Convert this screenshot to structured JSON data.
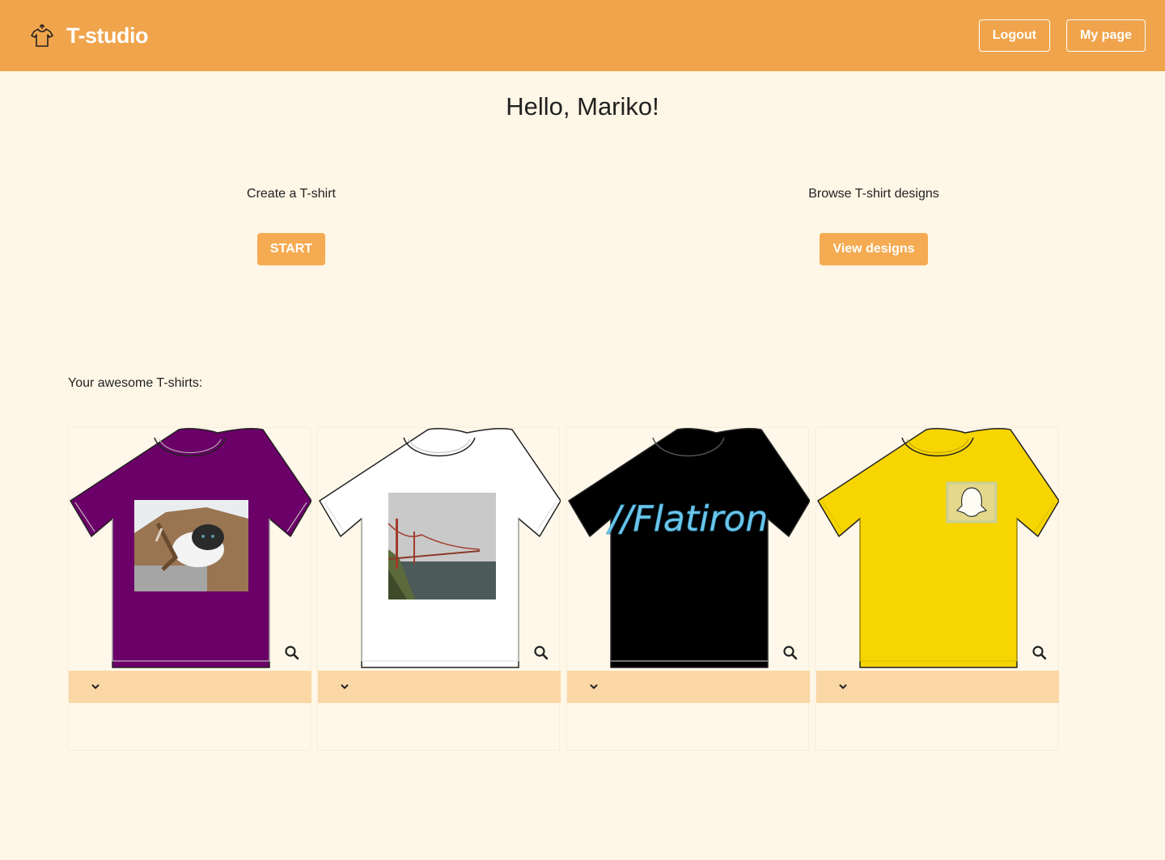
{
  "header": {
    "brand": "T-studio",
    "logo_icon": "tshirt-hanger-icon",
    "logout_label": "Logout",
    "mypage_label": "My page"
  },
  "greeting": "Hello, Mariko!",
  "create": {
    "label": "Create a T-shirt",
    "button": "START"
  },
  "browse": {
    "label": "Browse T-shirt designs",
    "button": "View designs"
  },
  "collection": {
    "title": "Your awesome T-shirts:",
    "shirts": [
      {
        "color": "#6b0068",
        "design": "cat-in-paper-bag-photo"
      },
      {
        "color": "#ffffff",
        "design": "golden-gate-bridge-photo"
      },
      {
        "color": "#000000",
        "design": "//Flatiron"
      },
      {
        "color": "#f7d500",
        "design": "snapchat-ghost-logo"
      }
    ]
  },
  "colors": {
    "header_bg": "#f0a44b",
    "page_bg": "#fef6e6",
    "button_bg": "#f5ab52",
    "card_bar_bg": "#fbd7a6"
  }
}
